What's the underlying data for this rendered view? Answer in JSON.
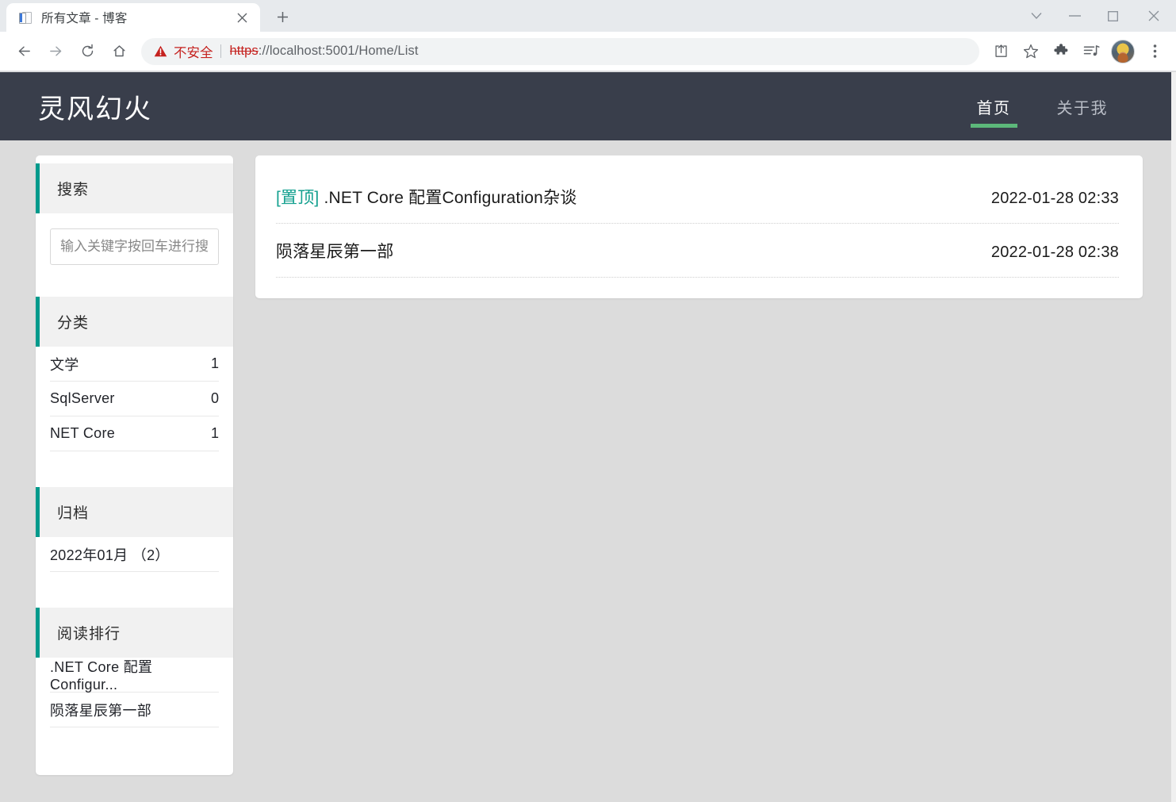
{
  "browser": {
    "tab": {
      "title": "所有文章 - 博客",
      "favicon": "document-icon",
      "close_label": "✕"
    },
    "new_tab_label": "+",
    "window_controls": [
      {
        "name": "tab-search",
        "glyph": "⌄"
      },
      {
        "name": "minimize",
        "glyph": "—"
      },
      {
        "name": "maximize",
        "glyph": "□"
      },
      {
        "name": "close",
        "glyph": "✕"
      }
    ],
    "toolbar": {
      "back": "back-arrow-icon",
      "forward": "forward-arrow-icon",
      "reload": "reload-icon",
      "home": "home-icon",
      "security_warning": "不安全",
      "url_scheme": "https",
      "url_rest": "://localhost:5001/Home/List",
      "url_host": "localhost",
      "url_full": "https://localhost:5001/Home/List",
      "icons": [
        "share-icon",
        "bookmark-star-icon",
        "extensions-puzzle-icon",
        "media-playlist-icon",
        "profile-avatar",
        "more-menu-icon"
      ]
    }
  },
  "site": {
    "title": "灵风幻火",
    "nav": [
      {
        "label": "首页",
        "active": true
      },
      {
        "label": "关于我",
        "active": false
      }
    ],
    "accent_green": "#5cb87a",
    "accent_teal": "#009a8c",
    "header_bg": "#393e4b",
    "page_bg": "#dcdcdc"
  },
  "sidebar": {
    "search": {
      "heading": "搜索",
      "placeholder": "输入关键字按回车进行搜索..",
      "value": ""
    },
    "categories": {
      "heading": "分类",
      "items": [
        {
          "label": "文学",
          "count": "1"
        },
        {
          "label": "SqlServer",
          "count": "0"
        },
        {
          "label": "NET Core",
          "count": "1"
        }
      ]
    },
    "archive": {
      "heading": "归档",
      "items": [
        {
          "label": "2022年01月 （2）"
        }
      ]
    },
    "ranking": {
      "heading": "阅读排行",
      "items": [
        {
          "label": ".NET Core 配置Configur..."
        },
        {
          "label": "陨落星辰第一部"
        }
      ]
    }
  },
  "main": {
    "posts": [
      {
        "sticky": "[置顶]",
        "title": " .NET Core 配置Configuration杂谈",
        "date": "2022-01-28 02:33"
      },
      {
        "sticky": "",
        "title": "陨落星辰第一部",
        "date": "2022-01-28 02:38"
      }
    ]
  }
}
